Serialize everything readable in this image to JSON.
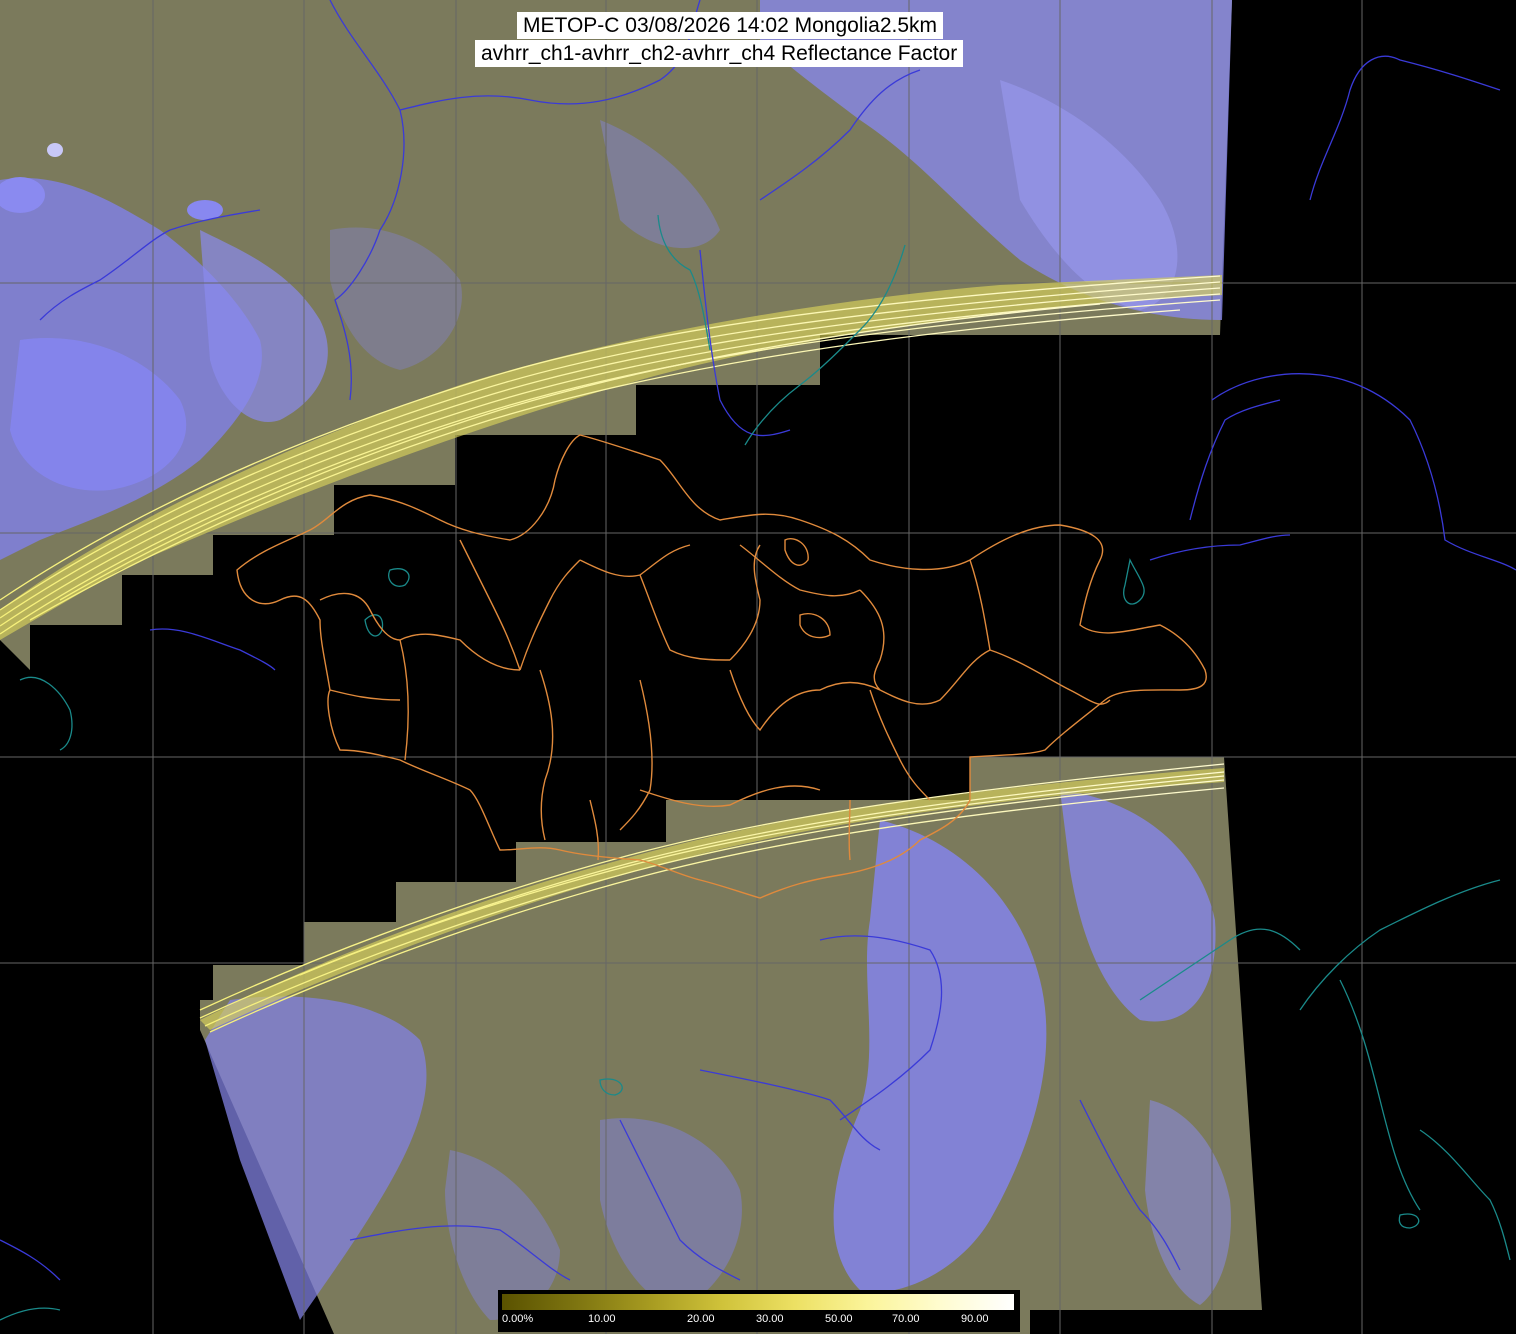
{
  "title": {
    "line1": "METOP-C 03/08/2026 14:02 Mongolia2.5km",
    "line2": "avhrr_ch1-avhrr_ch2-avhrr_ch4 Reflectance Factor"
  },
  "colorbar": {
    "labels": [
      "0.00%",
      "10.00",
      "20.00",
      "30.00",
      "50.00",
      "70.00",
      "90.00"
    ],
    "colors": [
      "#5a5200",
      "#7d7410",
      "#a69a20",
      "#cfc23a",
      "#ece063",
      "#fbf49a",
      "#fffcd0",
      "#ffffff"
    ]
  },
  "colors": {
    "background": "#000000",
    "land_olive": "#7b7a5c",
    "cloud_blue": "#8383e8",
    "grid": "#666666",
    "province_border": "#e08a3c",
    "river": "#3a3ad8",
    "coast": "#1a8a8a",
    "striping": "#f4ee6a"
  }
}
